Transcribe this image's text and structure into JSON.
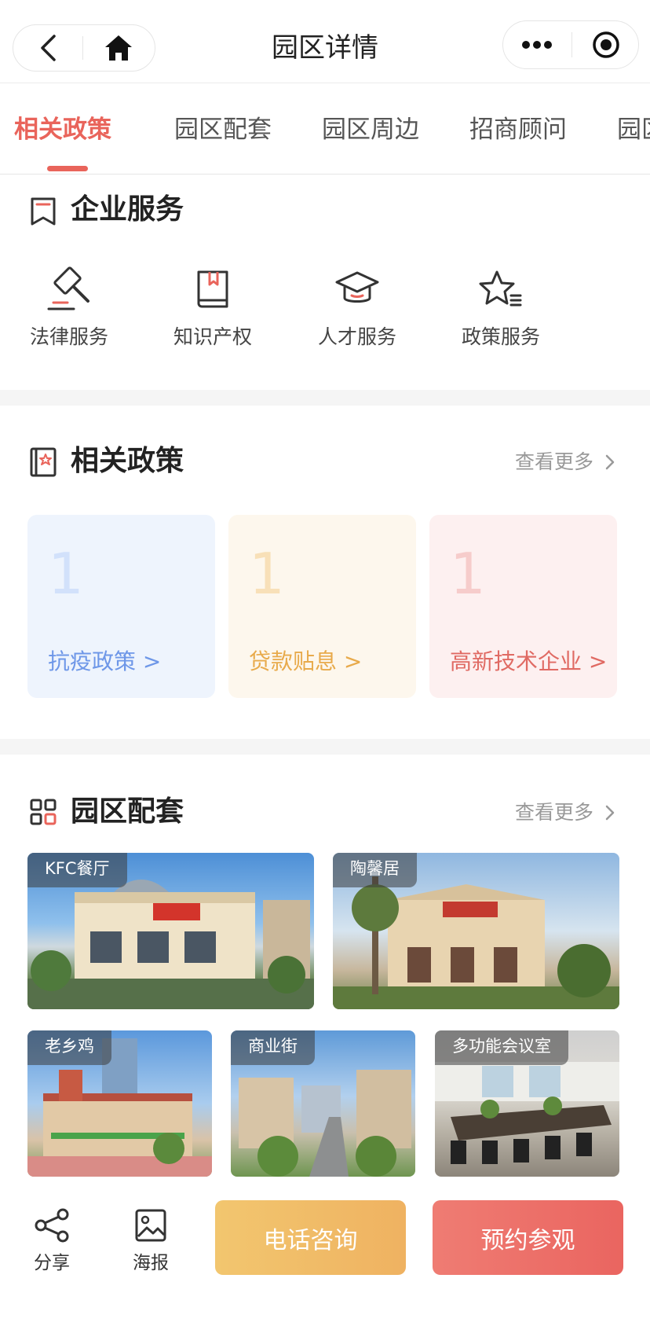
{
  "nav": {
    "title": "园区详情"
  },
  "tabs": [
    "相关政策",
    "园区配套",
    "园区周边",
    "招商顾问",
    "园区"
  ],
  "enterprise_services": {
    "title": "企业服务",
    "items": [
      {
        "label": "法律服务",
        "icon": "gavel-icon"
      },
      {
        "label": "知识产权",
        "icon": "book-icon"
      },
      {
        "label": "人才服务",
        "icon": "graduation-cap-icon"
      },
      {
        "label": "政策服务",
        "icon": "star-list-icon"
      }
    ]
  },
  "policies": {
    "title": "相关政策",
    "more": "查看更多",
    "cards": [
      {
        "count": "1",
        "label": "抗疫政策 >",
        "color": "#6e97e8",
        "bg": "#eef4fd",
        "num_color": "#d2e1fb"
      },
      {
        "count": "1",
        "label": "贷款贴息 >",
        "color": "#e8aa4b",
        "bg": "#fdf7ed",
        "num_color": "#f8e0b8"
      },
      {
        "count": "1",
        "label": "高新技术企业 >",
        "color": "#e06a63",
        "bg": "#fdf0f0",
        "num_color": "#f6cccb"
      }
    ]
  },
  "facilities": {
    "title": "园区配套",
    "more": "查看更多",
    "items": [
      "KFC餐厅",
      "陶馨居",
      "老乡鸡",
      "商业街",
      "多功能会议室"
    ]
  },
  "bottom": {
    "share": "分享",
    "poster": "海报",
    "call": "电话咨询",
    "visit": "预约参观",
    "call_color": "#f0b764",
    "visit_color": "#ec6d68"
  }
}
